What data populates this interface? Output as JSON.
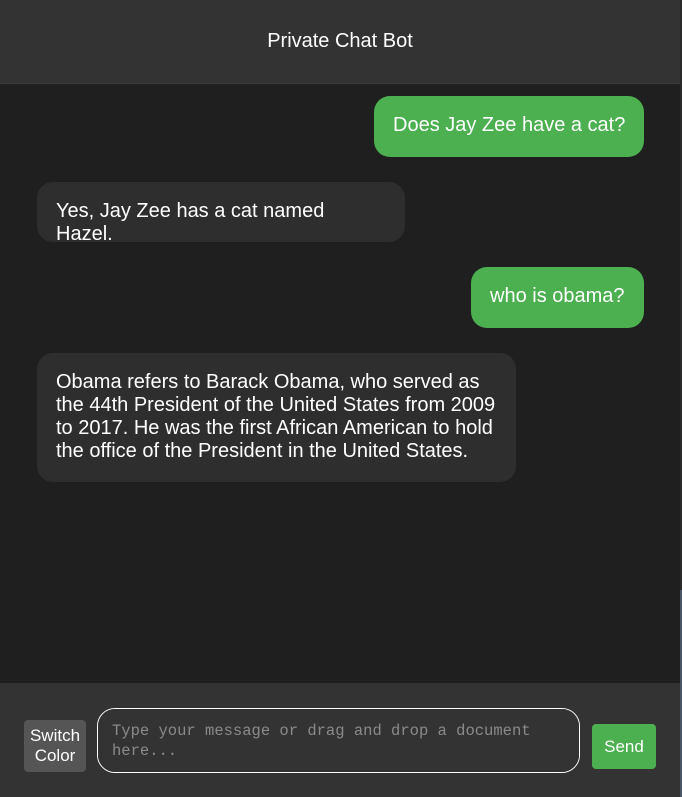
{
  "header": {
    "title": "Private Chat Bot"
  },
  "messages": [
    {
      "role": "user",
      "text": "Does Jay Zee have a cat?"
    },
    {
      "role": "bot",
      "text": "Yes, Jay Zee has a cat named Hazel."
    },
    {
      "role": "user",
      "text": "who is obama?"
    },
    {
      "role": "bot",
      "text": "Obama refers to Barack Obama, who served as the 44th President of the United States from 2009 to 2017. He was the first African American to hold the office of the President in the United States."
    }
  ],
  "footer": {
    "switch_color_label": "Switch Color",
    "input_placeholder": "Type your message or drag and drop a document here...",
    "input_value": "",
    "send_label": "Send"
  },
  "colors": {
    "user_bubble": "#4caf50",
    "bot_bubble": "#2e2e2e",
    "header_bg": "#333333",
    "chat_bg": "#1f1f1f",
    "send_button": "#4caf50",
    "switch_button": "#555555"
  }
}
